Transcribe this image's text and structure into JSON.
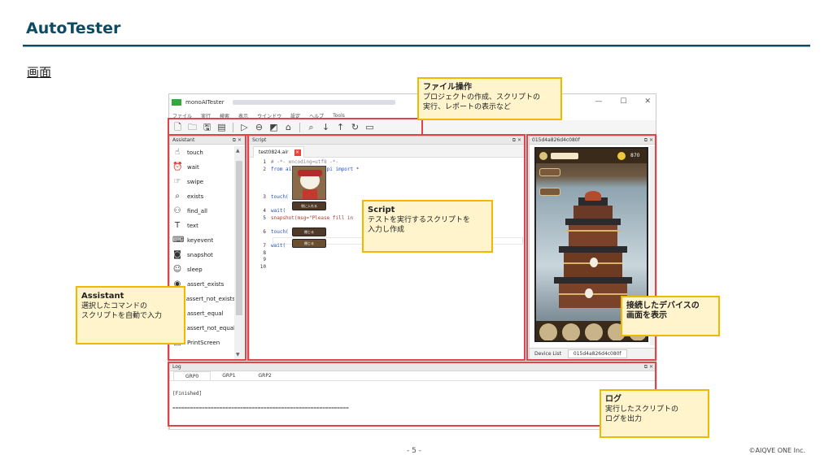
{
  "slide": {
    "title": "AutoTester",
    "section": "画面",
    "page_number": "- 5 -",
    "copyright": "©AIQVE ONE Inc."
  },
  "app": {
    "name": "monoAITester",
    "window_controls": [
      "—",
      "☐",
      "✕"
    ],
    "menu": [
      "ファイル",
      "実行",
      "検索",
      "表示",
      "ウインドウ",
      "設定",
      "ヘルプ",
      "Tools"
    ],
    "toolbar_icons": [
      "new-file-icon",
      "open-folder-icon",
      "save-icon",
      "save-as-icon",
      "run-icon",
      "stop-icon",
      "report-icon",
      "home-icon",
      "search-icon",
      "step-down-icon",
      "step-up-icon",
      "refresh-icon",
      "device-icon"
    ]
  },
  "assistant": {
    "title": "Assistant",
    "controls": "⧉  ✕",
    "items": [
      {
        "label": "touch",
        "icon": "touch-icon",
        "glyph": "☝"
      },
      {
        "label": "wait",
        "icon": "alarm-icon",
        "glyph": "⏰"
      },
      {
        "label": "swipe",
        "icon": "swipe-icon",
        "glyph": "☞"
      },
      {
        "label": "exists",
        "icon": "magnifier-icon",
        "glyph": "⌕"
      },
      {
        "label": "find_all",
        "icon": "binoculars-icon",
        "glyph": "⚇"
      },
      {
        "label": "text",
        "icon": "text-icon",
        "glyph": "T"
      },
      {
        "label": "keyevent",
        "icon": "keyboard-icon",
        "glyph": "⌨"
      },
      {
        "label": "snapshot",
        "icon": "camera-icon",
        "glyph": "◙"
      },
      {
        "label": "sleep",
        "icon": "sleep-icon",
        "glyph": "☺"
      },
      {
        "label": "assert_exists",
        "icon": "assert-icon",
        "glyph": "◉"
      },
      {
        "label": "assert_not_exists",
        "icon": "assert-not-icon",
        "glyph": "◎"
      },
      {
        "label": "assert_equal",
        "icon": "assert-equal-icon",
        "glyph": "="
      },
      {
        "label": "assert_not_equal",
        "icon": "assert-not-equal-icon",
        "glyph": "≠"
      },
      {
        "label": "PrintScreen",
        "icon": "printscreen-icon",
        "glyph": "▣"
      }
    ]
  },
  "script": {
    "title": "Script",
    "controls": "⧉  ✕",
    "tab": "test0824.air",
    "tab_close": "×",
    "lines": [
      {
        "n": "1",
        "t": "# -*- encoding=utf8 -*-"
      },
      {
        "n": "2",
        "t": "from airtest.core.api import *"
      },
      {
        "n": "3",
        "t": "touch("
      },
      {
        "n": "4",
        "t": "wait("
      },
      {
        "n": "5",
        "t": "snapshot(msg=\"Please fill in"
      },
      {
        "n": "6",
        "t": "touch("
      },
      {
        "n": "7",
        "t": "wait("
      },
      {
        "n": "8",
        "t": ""
      },
      {
        "n": "9",
        "t": ""
      },
      {
        "n": "10",
        "t": ""
      }
    ],
    "button_text_1": "袋に入れる",
    "button_text_2": "閉じる"
  },
  "device": {
    "title": "015d4a826d4c080f",
    "controls": "⧉  ✕",
    "footer_label": "Device List",
    "footer_id": "015d4a826d4c080f",
    "game_text": "870"
  },
  "log": {
    "title": "Log",
    "controls": "⧉  ✕",
    "tabs": [
      "GRP0",
      "GRP1",
      "GRP2"
    ],
    "lines": [
      "[Finished]",
      "============================================================"
    ]
  },
  "callouts": {
    "file_ops": {
      "title": "ファイル操作",
      "body": "プロジェクトの作成、スクリプトの\n実行、レポートの表示など"
    },
    "script": {
      "title": "Script",
      "body": "テストを実行するスクリプトを\n入力し作成"
    },
    "assistant": {
      "title": "Assistant",
      "body": "選択したコマンドの\nスクリプトを自動で入力"
    },
    "device": {
      "title": "接続したデバイスの\n画面を表示",
      "body": ""
    },
    "log": {
      "title": "ログ",
      "body": "実行したスクリプトの\nログを出力"
    }
  },
  "colors": {
    "accent": "#0d4a63",
    "highlight_red": "#e0434a",
    "callout_bg": "#fff4cc",
    "callout_border": "#f2b800"
  }
}
